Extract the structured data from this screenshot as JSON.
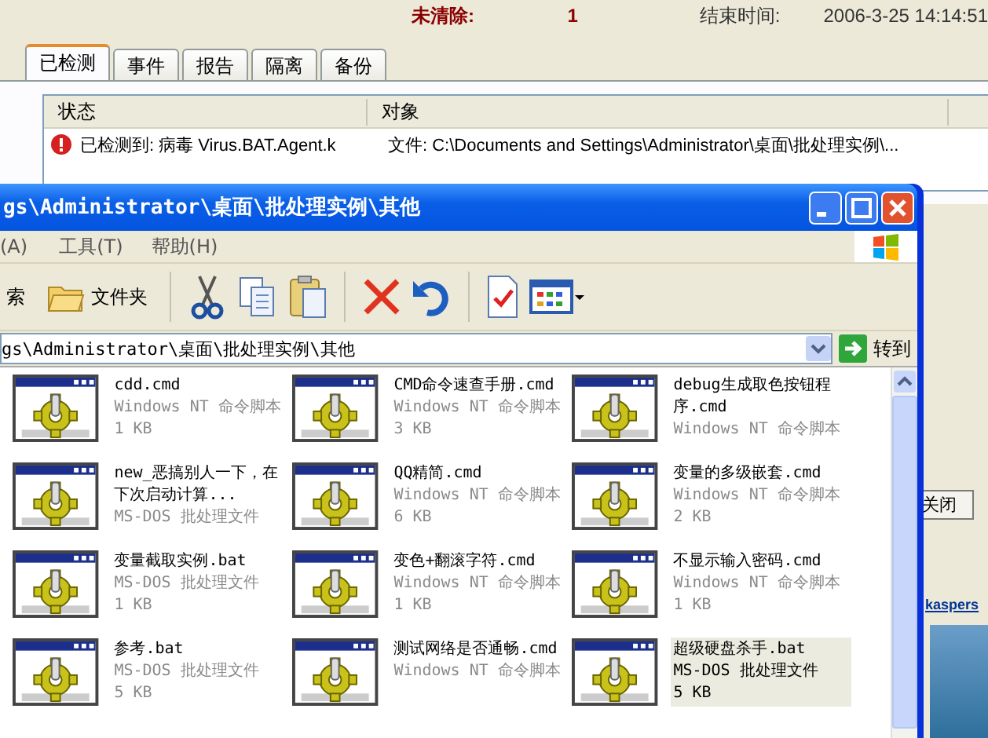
{
  "summary": {
    "label": "未清除:",
    "count": "1",
    "end_label": "结束时间:",
    "end_time": "2006-3-25 14:14:51"
  },
  "tabs": [
    {
      "label": "已检测",
      "selected": true
    },
    {
      "label": "事件",
      "selected": false
    },
    {
      "label": "报告",
      "selected": false
    },
    {
      "label": "隔离",
      "selected": false
    },
    {
      "label": "备份",
      "selected": false
    }
  ],
  "detections": {
    "columns": [
      "状态",
      "对象"
    ],
    "rows": [
      {
        "status": "已检测到: 病毒 Virus.BAT.Agent.k",
        "object": "文件: C:\\Documents and Settings\\Administrator\\桌面\\批处理实例\\..."
      }
    ]
  },
  "side": {
    "close_button": "关闭",
    "link": "kaspers"
  },
  "explorer": {
    "title": "gs\\Administrator\\桌面\\批处理实例\\其他",
    "menu": [
      "(A)",
      "工具(T)",
      "帮助(H)"
    ],
    "toolbar": {
      "search": "索",
      "folders": "文件夹"
    },
    "address": "gs\\Administrator\\桌面\\批处理实例\\其他",
    "go": "转到",
    "files": [
      {
        "name": "cdd.cmd",
        "type": "Windows NT 命令脚本",
        "size": "1 KB",
        "selected": false
      },
      {
        "name": "CMD命令速查手册.cmd",
        "type": "Windows NT 命令脚本",
        "size": "3 KB",
        "selected": false
      },
      {
        "name": "debug生成取色按钮程序.cmd",
        "type": "Windows NT 命令脚本",
        "selected": false
      },
      {
        "name": "new_恶搞别人一下，在下次启动计算...",
        "type": "MS-DOS 批处理文件",
        "selected": false
      },
      {
        "name": "QQ精简.cmd",
        "type": "Windows NT 命令脚本",
        "size": "6 KB",
        "selected": false
      },
      {
        "name": "变量的多级嵌套.cmd",
        "type": "Windows NT 命令脚本",
        "size": "2 KB",
        "selected": false
      },
      {
        "name": "变量截取实例.bat",
        "type": "MS-DOS 批处理文件",
        "size": "1 KB",
        "selected": false
      },
      {
        "name": "变色+翻滚字符.cmd",
        "type": "Windows NT 命令脚本",
        "size": "1 KB",
        "selected": false
      },
      {
        "name": "不显示输入密码.cmd",
        "type": "Windows NT 命令脚本",
        "size": "1 KB",
        "selected": false
      },
      {
        "name": "参考.bat",
        "type": "MS-DOS 批处理文件",
        "size": "5 KB",
        "selected": false
      },
      {
        "name": "测试网络是否通畅.cmd",
        "type": "Windows NT 命令脚本",
        "selected": false
      },
      {
        "name": "超级硬盘杀手.bat",
        "type": "MS-DOS 批处理文件",
        "size": "5 KB",
        "selected": true
      }
    ]
  }
}
